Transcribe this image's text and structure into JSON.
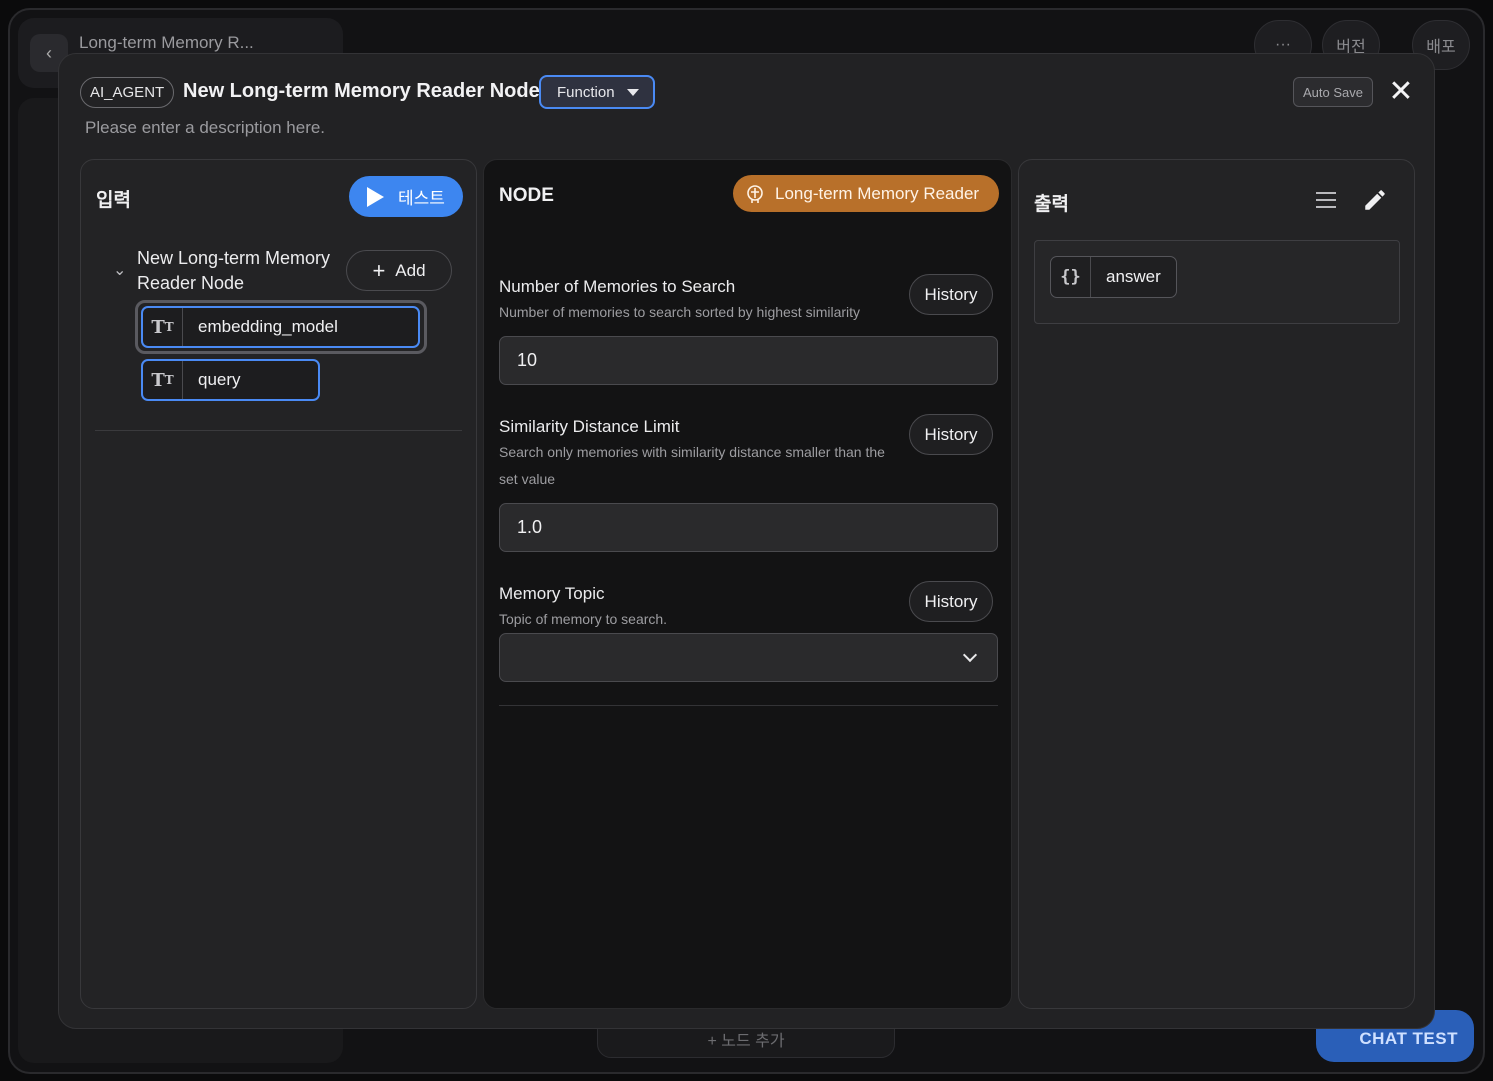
{
  "background": {
    "title": "Long-term Memory R...",
    "more_label": "···",
    "version_label": "버전",
    "deploy_label": "배포",
    "toolbar_label": "+ 노드 추가",
    "chat_test_label": "CHAT TEST"
  },
  "modal": {
    "type_chip": "AI_AGENT",
    "title": "New Long-term Memory Reader Node",
    "mode_select": "Function",
    "description_placeholder": "Please enter a description here.",
    "auto_save_label": "Auto Save",
    "close_glyph": "✕"
  },
  "input_panel": {
    "title": "입력",
    "test_button": "테스트",
    "node_label": "New Long-term Memory Reader Node",
    "add_button": "Add",
    "params": [
      {
        "name": "embedding_model",
        "type_icon": "text-type-icon"
      },
      {
        "name": "query",
        "type_icon": "text-type-icon"
      }
    ]
  },
  "node_panel": {
    "title": "NODE",
    "badge": "Long-term Memory Reader",
    "fields": [
      {
        "label": "Number of Memories to Search",
        "help": "Number of memories to search sorted by highest similarity",
        "history": "History",
        "value": "10"
      },
      {
        "label": "Similarity Distance Limit",
        "help": "Search only memories with similarity distance smaller than the set value",
        "history": "History",
        "value": "1.0"
      },
      {
        "label": "Memory Topic",
        "help": "Topic of memory to search.",
        "history": "History",
        "value": ""
      }
    ]
  },
  "output_panel": {
    "title": "출력",
    "outputs": [
      {
        "name": "answer",
        "type_icon": "json-braces-icon"
      }
    ]
  },
  "colors": {
    "accent": "#3d86f0",
    "badge_orange": "#b8702a",
    "modal_bg": "#222224",
    "node_panel_bg": "#131314"
  }
}
